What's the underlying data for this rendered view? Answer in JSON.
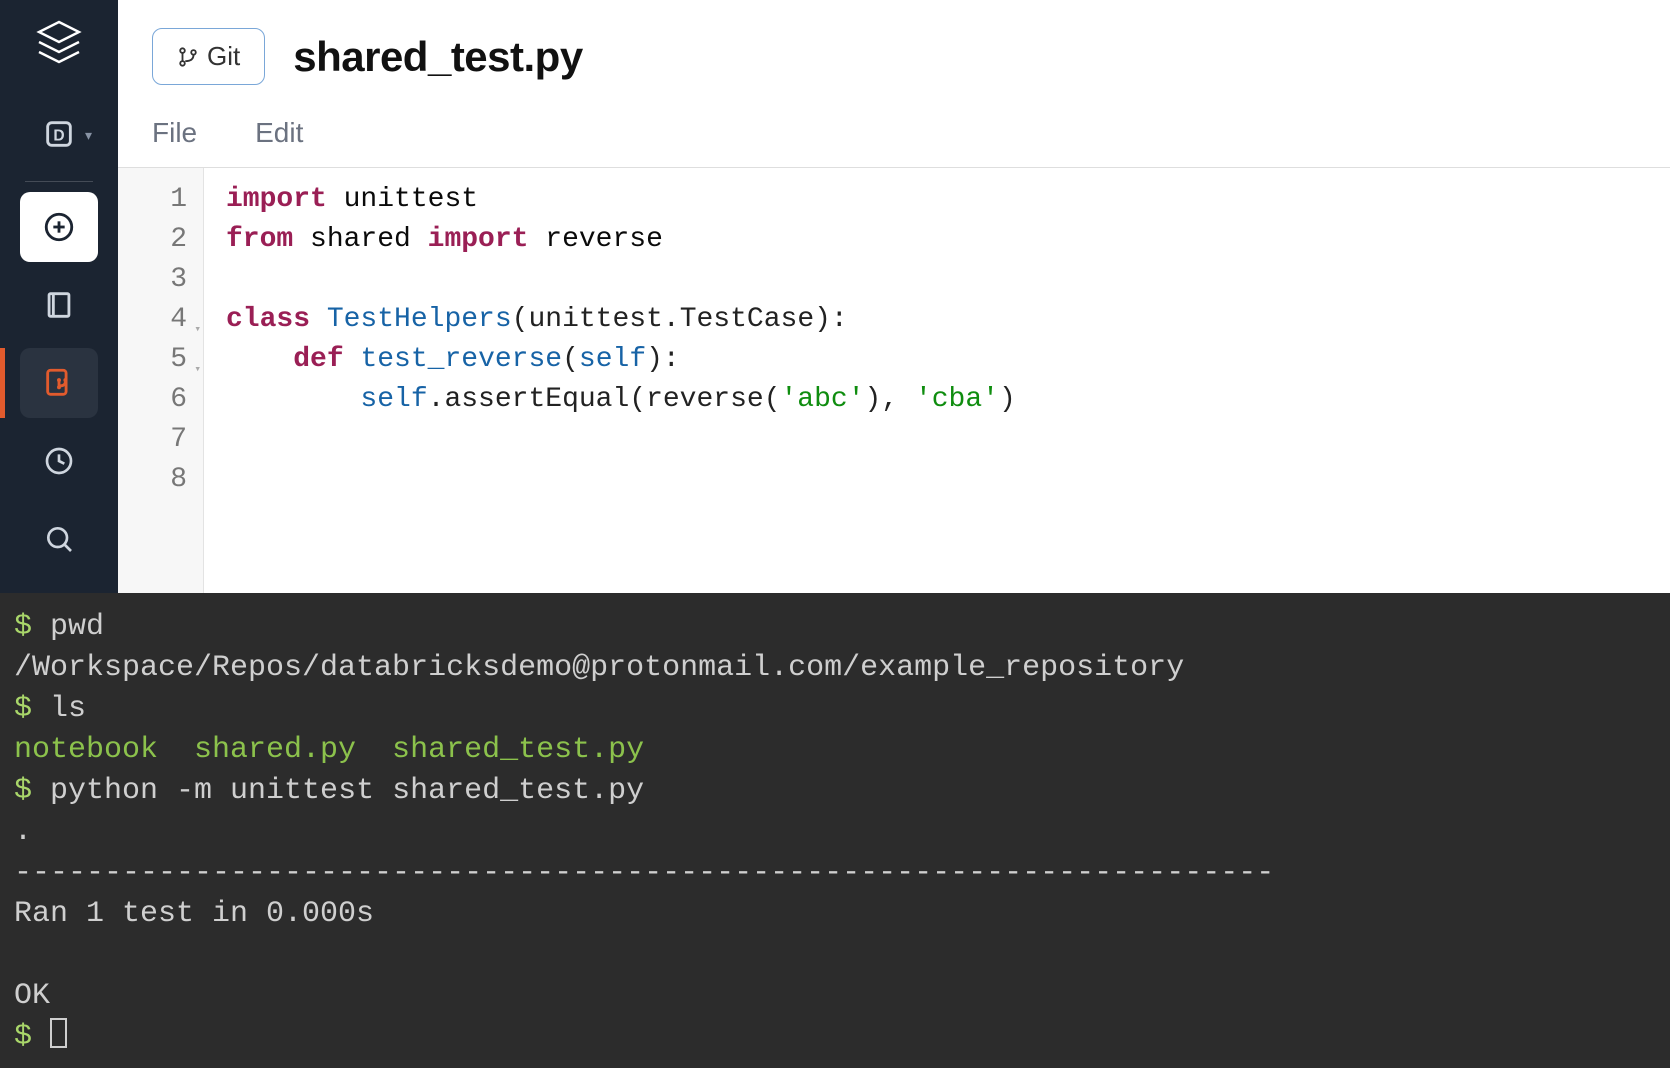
{
  "header": {
    "git_label": "Git",
    "title": "shared_test.py"
  },
  "menu": {
    "file": "File",
    "edit": "Edit"
  },
  "editor": {
    "lines": {
      "1": {
        "num": "1",
        "fold": ""
      },
      "2": {
        "num": "2",
        "fold": ""
      },
      "3": {
        "num": "3",
        "fold": ""
      },
      "4": {
        "num": "4",
        "fold": "▾"
      },
      "5": {
        "num": "5",
        "fold": "▾"
      },
      "6": {
        "num": "6",
        "fold": ""
      },
      "7": {
        "num": "7",
        "fold": ""
      },
      "8": {
        "num": "8",
        "fold": ""
      }
    },
    "code": {
      "l1_kw": "import",
      "l1_rest": " unittest",
      "l2_kw1": "from",
      "l2_mid": " shared ",
      "l2_kw2": "import",
      "l2_rest": " reverse",
      "l4_kw": "class",
      "l4_sp": " ",
      "l4_cls": "TestHelpers",
      "l4_rest": "(unittest.TestCase):",
      "l5_indent": "    ",
      "l5_kw": "def",
      "l5_sp": " ",
      "l5_fn": "test_reverse",
      "l5_open": "(",
      "l5_self": "self",
      "l5_close": "):",
      "l6_indent": "        ",
      "l6_self": "self",
      "l6_call1": ".assertEqual(reverse(",
      "l6_str1": "'abc'",
      "l6_mid": "), ",
      "l6_str2": "'cba'",
      "l6_end": ")"
    }
  },
  "terminal": {
    "l1_prompt": "$ ",
    "l1_cmd": "pwd",
    "l2": "/Workspace/Repos/databricksdemo@protonmail.com/example_repository",
    "l3_prompt": "$ ",
    "l3_cmd": "ls",
    "l4_files": "notebook  shared.py  shared_test.py",
    "l5_prompt": "$ ",
    "l5_cmd": "python -m unittest shared_test.py",
    "l6": ".",
    "l7": "----------------------------------------------------------------------",
    "l8": "Ran 1 test in 0.000s",
    "l9": "",
    "l10": "OK",
    "l11_prompt": "$ "
  }
}
